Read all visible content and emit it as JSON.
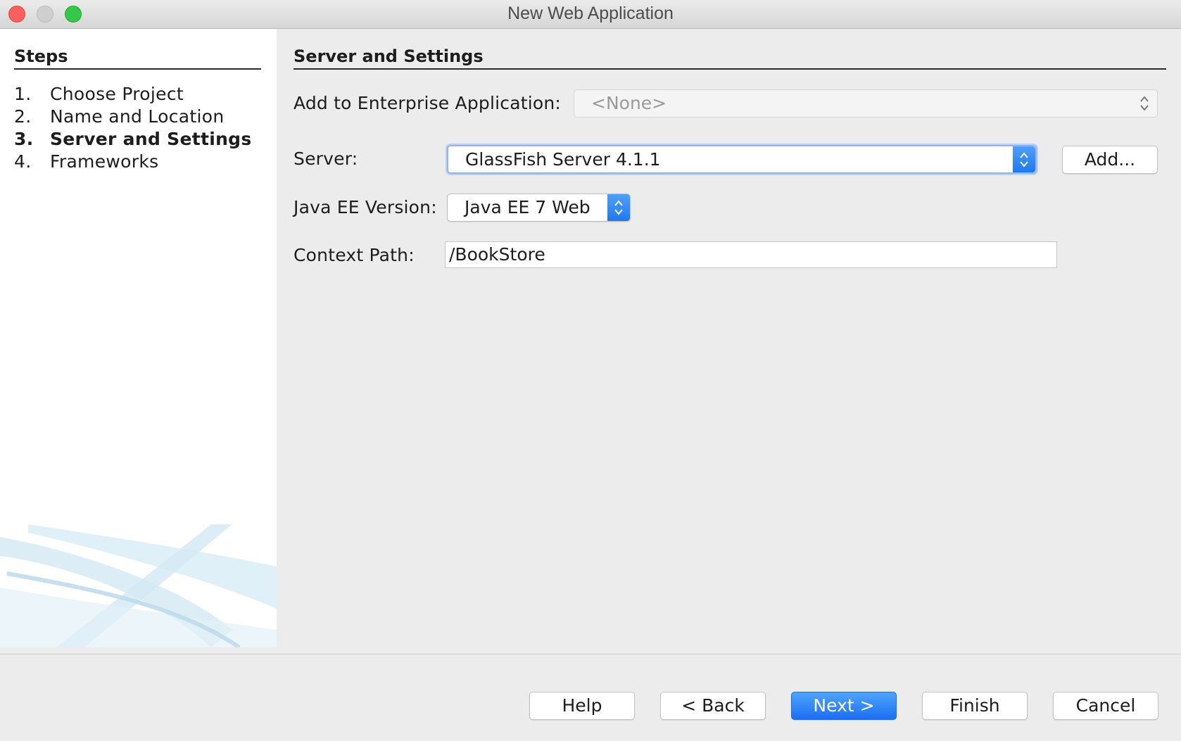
{
  "window": {
    "title": "New Web Application"
  },
  "sidebar": {
    "heading": "Steps",
    "steps": [
      {
        "number": "1.",
        "label": "Choose Project"
      },
      {
        "number": "2.",
        "label": "Name and Location"
      },
      {
        "number": "3.",
        "label": "Server and Settings",
        "current": true
      },
      {
        "number": "4.",
        "label": "Frameworks"
      }
    ]
  },
  "main": {
    "heading": "Server and Settings",
    "enterprise": {
      "label": "Add to Enterprise Application:",
      "value": "<None>",
      "disabled": true
    },
    "server": {
      "label": "Server:",
      "value": "GlassFish Server 4.1.1",
      "add_label": "Add..."
    },
    "javaee": {
      "label": "Java EE Version:",
      "value": "Java EE 7 Web"
    },
    "context": {
      "label": "Context Path:",
      "value": "/BookStore"
    }
  },
  "footer": {
    "help": "Help",
    "back": "< Back",
    "next": "Next >",
    "finish": "Finish",
    "cancel": "Cancel"
  },
  "colors": {
    "accent": "#1f78ee",
    "window_bg": "#ececec",
    "sidebar_bg": "#ffffff"
  }
}
